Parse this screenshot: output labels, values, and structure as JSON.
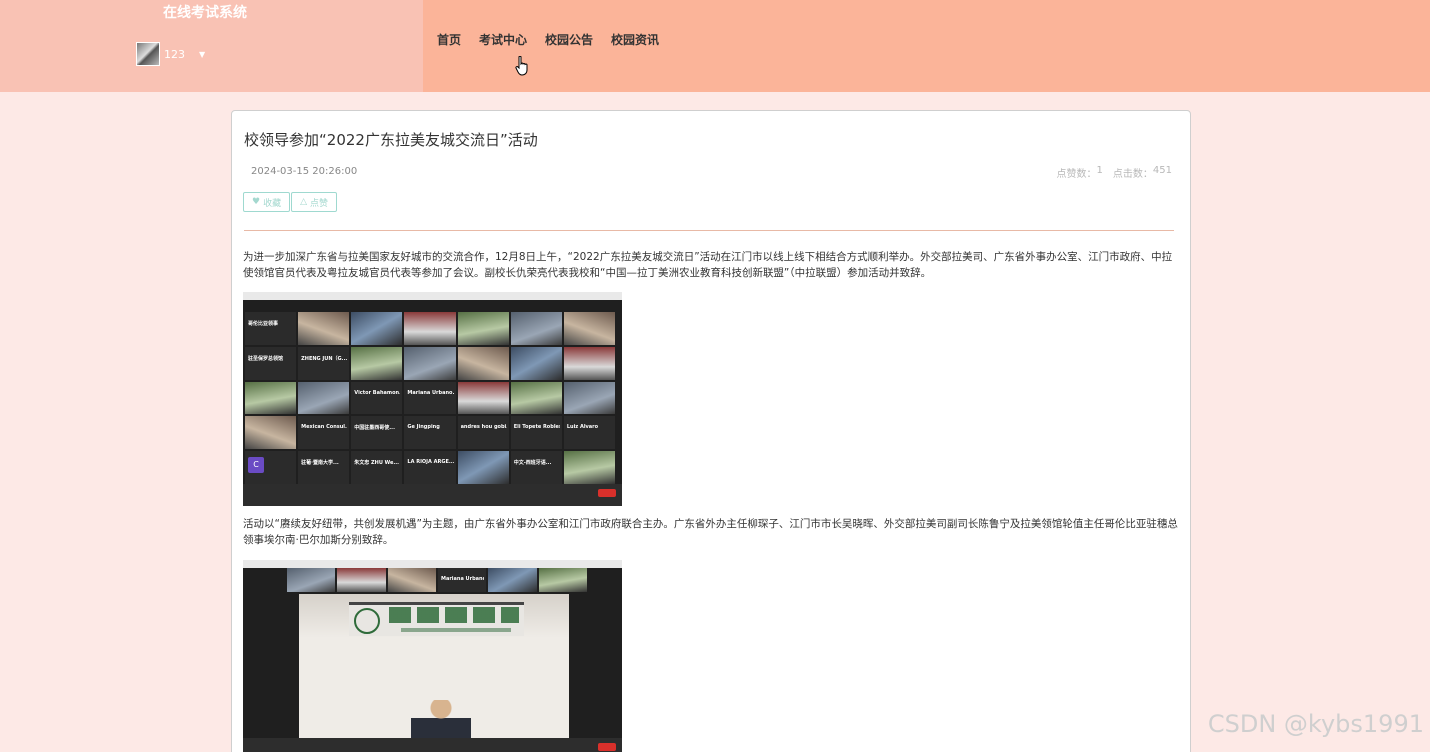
{
  "header": {
    "site_title": "在线考试系统",
    "user": {
      "name": "123"
    },
    "nav": [
      "首页",
      "考试中心",
      "校园公告",
      "校园资讯"
    ]
  },
  "article": {
    "title": "校领导参加“2022广东拉美友城交流日”活动",
    "date": "2024-03-15 20:26:00",
    "likes_label": "点赞数：",
    "likes": "1",
    "clicks_label": "点击数：",
    "clicks": "451",
    "buttons": {
      "favorite": "收藏",
      "like": "点赞"
    },
    "paragraphs": [
      "为进一步加深广东省与拉美国家友好城市的交流合作，12月8日上午，“2022广东拉美友城交流日”活动在江门市以线上线下相结合方式顺利举办。外交部拉美司、广东省外事办公室、江门市政府、中拉使领馆官员代表及粤拉友城官员代表等参加了会议。副校长仇荣亮代表我校和“中国—拉丁美洲农业教育科技创新联盟”（中拉联盟）参加活动并致辞。",
      "活动以“赓续友好纽带，共创发展机遇”为主题，由广东省外事办公室和江门市政府联合主办。广东省外办主任柳琛子、江门市市长吴晓晖、外交部拉美司副司长陈鲁宁及拉美领馆轮值主任哥伦比亚驻穗总领事埃尔南·巴尔加斯分别致辞。"
    ],
    "meeting_tiles": [
      "哥伦比亚领事",
      "",
      "",
      "",
      "",
      "",
      "",
      "驻圣保罗总领馆",
      "ZHENG JUN（G...",
      "",
      "",
      "",
      "",
      "",
      "",
      "",
      "Victor Bahamon...",
      "Mariana Urbano...",
      "",
      "",
      "",
      "",
      "Mexican Consul...",
      "中国驻墨西哥使...",
      "Ge Jingping",
      "andres hou gobi...",
      "Eli Topete Robles",
      "Luiz Alvaro",
      "C",
      "驻葡·暨南大学...",
      "朱文忠 ZHU We...",
      "LA RIOJA ARGE...",
      "",
      "中文-西班牙语...",
      ""
    ],
    "second_shot_label": "Mariana Urbano..."
  },
  "watermark": "CSDN @kybs1991"
}
